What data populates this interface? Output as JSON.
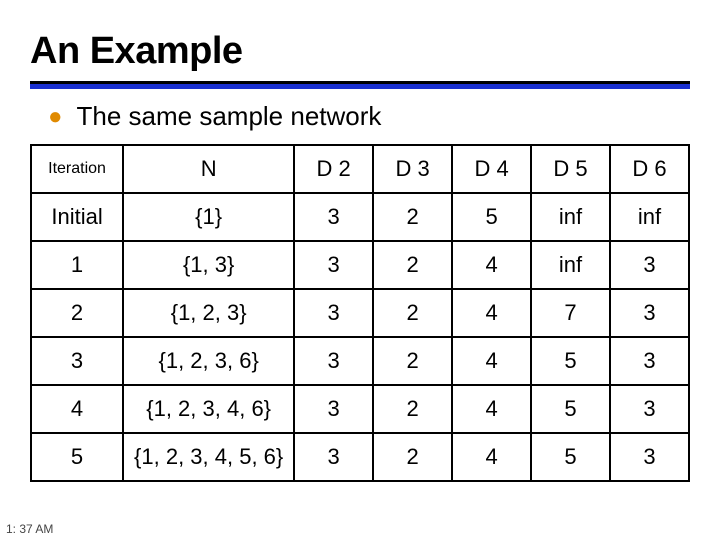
{
  "title": "An Example",
  "bullet": "The same sample network",
  "timestamp": "1: 37 AM",
  "chart_data": {
    "type": "table",
    "headers": [
      "Iteration",
      "N",
      "D 2",
      "D 3",
      "D 4",
      "D 5",
      "D 6"
    ],
    "rows": [
      {
        "iter": "Initial",
        "n": "{1}",
        "d2": "3",
        "d3": "2",
        "d4": "5",
        "d5": "inf",
        "d6": "inf"
      },
      {
        "iter": "1",
        "n": "{1, 3}",
        "d2": "3",
        "d3": "2",
        "d4": "4",
        "d5": "inf",
        "d6": "3"
      },
      {
        "iter": "2",
        "n": "{1, 2, 3}",
        "d2": "3",
        "d3": "2",
        "d4": "4",
        "d5": "7",
        "d6": "3"
      },
      {
        "iter": "3",
        "n": "{1, 2, 3, 6}",
        "d2": "3",
        "d3": "2",
        "d4": "4",
        "d5": "5",
        "d6": "3"
      },
      {
        "iter": "4",
        "n": "{1, 2, 3, 4, 6}",
        "d2": "3",
        "d3": "2",
        "d4": "4",
        "d5": "5",
        "d6": "3"
      },
      {
        "iter": "5",
        "n": "{1, 2, 3, 4, 5, 6}",
        "d2": "3",
        "d3": "2",
        "d4": "4",
        "d5": "5",
        "d6": "3"
      }
    ]
  }
}
